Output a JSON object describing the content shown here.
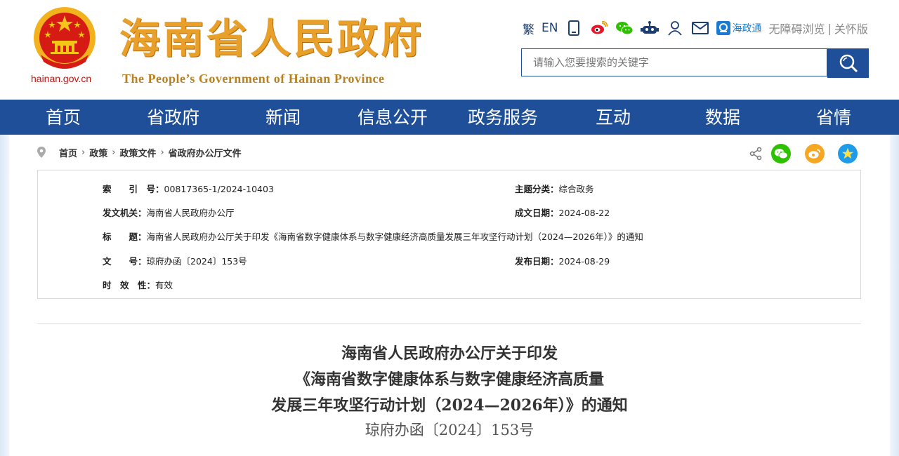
{
  "header": {
    "domain": "hainan.gov.cn",
    "title": "海南省人民政府",
    "subtitle": "The People’s Government  of Hainan Province"
  },
  "toolbar": {
    "traditional": "繁",
    "english": "EN",
    "hzt_label": "海政通",
    "accessibility": "无障碍浏览",
    "separator": "|",
    "elderly": "关怀版"
  },
  "search": {
    "placeholder": "请输入您要搜索的关键字"
  },
  "nav": {
    "items": [
      "首页",
      "省政府",
      "新闻",
      "信息公开",
      "政务服务",
      "互动",
      "数据",
      "省情"
    ]
  },
  "breadcrumb": {
    "items": [
      "首页",
      "政策",
      "政策文件",
      "省政府办公厅文件"
    ],
    "sep": "›"
  },
  "info": {
    "index_label": "索　　引　号：",
    "index_value": "00817365-1/2024-10403",
    "topic_label": "主题分类：",
    "topic_value": "综合政务",
    "issuer_label": "发文机关：",
    "issuer_value": "海南省人民政府办公厅",
    "created_label": "成文日期：",
    "created_value": "2024-08-22",
    "title_label": "标　　题：",
    "title_value": "海南省人民政府办公厅关于印发《海南省数字健康体系与数字健康经济高质量发展三年攻坚行动计划（2024—2026年）》的通知",
    "docno_label": "文　　号：",
    "docno_value": "琼府办函〔2024〕153号",
    "published_label": "发布日期：",
    "published_value": "2024-08-29",
    "validity_label": "时　效　性：",
    "validity_value": "有效"
  },
  "document": {
    "title_line1": "海南省人民政府办公厅关于印发",
    "title_line2": "《海南省数字健康体系与数字健康经济高质量",
    "title_line3": "发展三年攻坚行动计划（2024—2026年）》的通知",
    "doc_number": "琼府办函〔2024〕153号"
  },
  "colors": {
    "brand_blue": "#1e4f98",
    "title_gold": "#e8a02a",
    "wechat_green": "#2dc100",
    "weibo_orange": "#f5a623",
    "qzone_blue": "#1e9be9"
  },
  "icons": [
    "share-icon",
    "wechat-icon",
    "weibo-icon",
    "qzone-icon",
    "search-icon",
    "location-icon",
    "mobile-icon",
    "robot-icon",
    "user-icon",
    "mail-icon"
  ]
}
